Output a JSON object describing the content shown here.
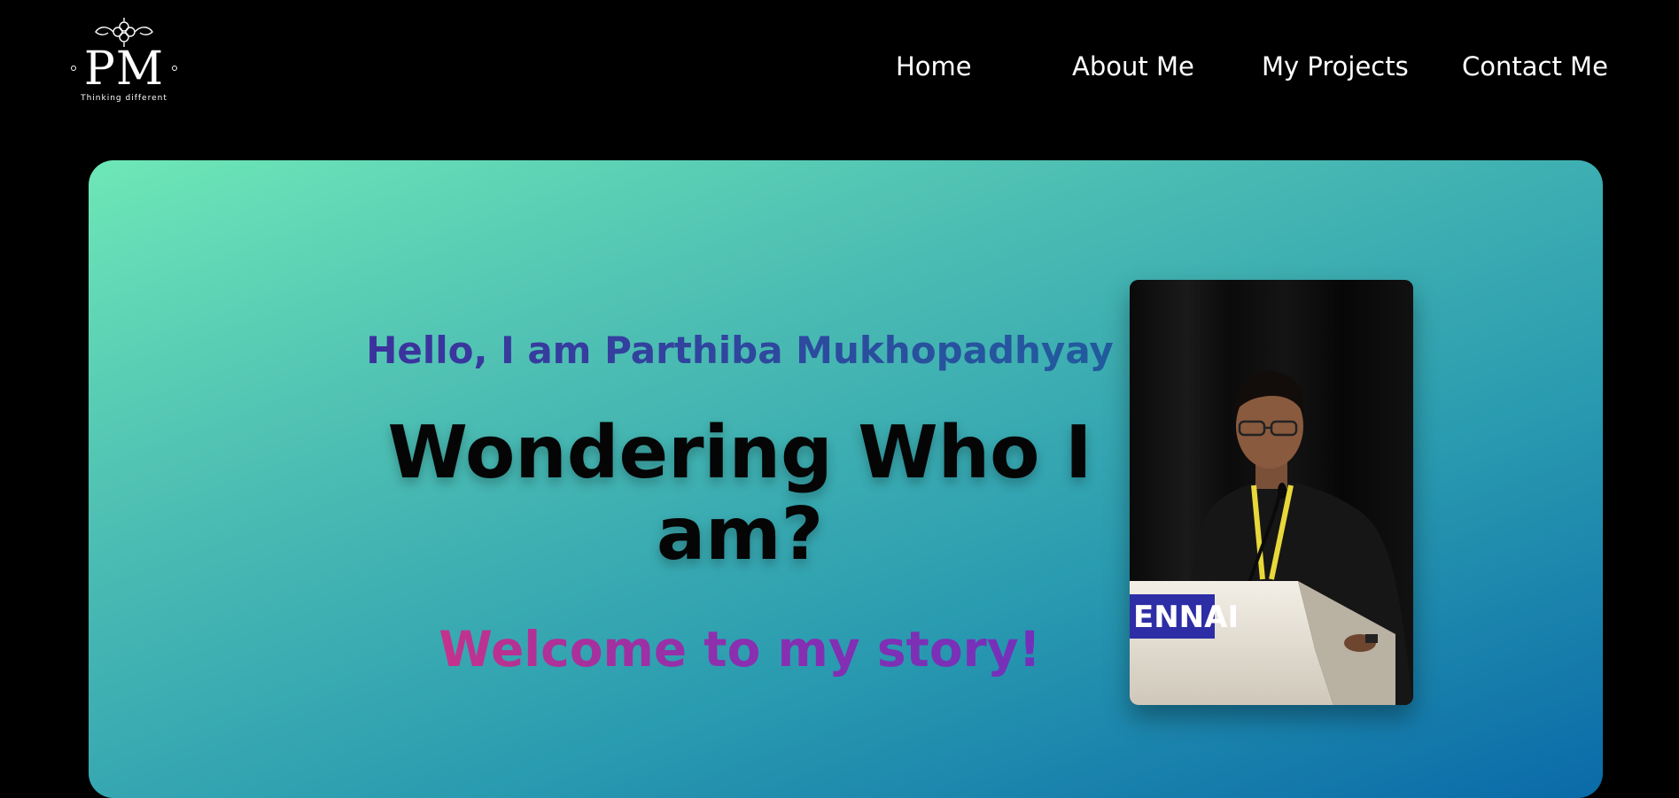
{
  "logo": {
    "initials": "PM",
    "tagline": "Thinking different"
  },
  "nav": {
    "items": [
      {
        "label": "Home"
      },
      {
        "label": "About Me"
      },
      {
        "label": "My Projects"
      },
      {
        "label": "Contact Me"
      }
    ]
  },
  "hero": {
    "greeting": "Hello, I am Parthiba Mukhopadhyay",
    "headline": "Wondering Who I am?",
    "tagline": "Welcome to my story!",
    "podium_text": "ENNAI"
  },
  "colors": {
    "background": "#000000",
    "hero_gradient_start": "#6ee7b7",
    "hero_gradient_end": "#0a6aa8",
    "greeting": "#3b3aa0",
    "welcome_start": "#e0337a",
    "welcome_end": "#6a30c0"
  }
}
